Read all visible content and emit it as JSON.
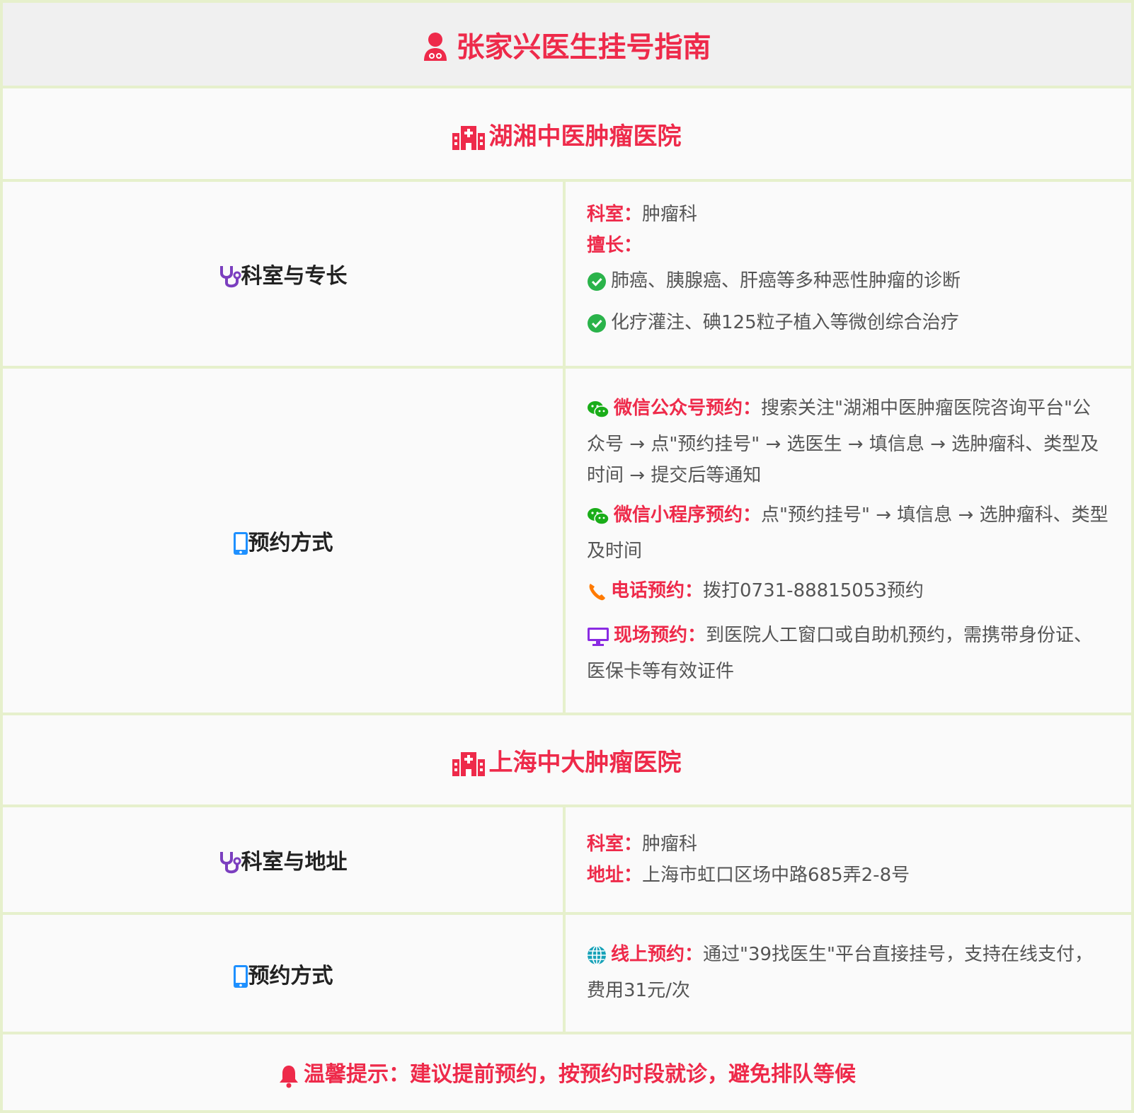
{
  "title": {
    "icon": "doctor-icon",
    "text": "张家兴医生挂号指南"
  },
  "hospitals": [
    {
      "icon": "hospital-icon",
      "name": "湖湘中医肿瘤医院",
      "dept_label": "科室与专长",
      "dept_label_icon": "stethoscope-icon",
      "dept_key": "科室：",
      "dept_value": "肿瘤科",
      "specialty_key": "擅长：",
      "specialties": [
        "肺癌、胰腺癌、肝癌等多种恶性肿瘤的诊断",
        "化疗灌注、碘125粒子植入等微创综合治疗"
      ],
      "booking_label": "预约方式",
      "booking_label_icon": "mobile-icon",
      "booking": [
        {
          "icon": "wechat-icon",
          "key": "微信公众号预约：",
          "text": "搜索关注\"湖湘中医肿瘤医院咨询平台\"公众号 → 点\"预约挂号\" → 选医生 → 填信息 → 选肿瘤科、类型及时间 → 提交后等通知"
        },
        {
          "icon": "wechat-icon",
          "key": "微信小程序预约：",
          "text": "点\"预约挂号\" → 填信息 → 选肿瘤科、类型及时间"
        },
        {
          "icon": "phone-icon",
          "key": "电话预约：",
          "text": "拨打0731-88815053预约"
        },
        {
          "icon": "desktop-icon",
          "key": "现场预约：",
          "text": "到医院人工窗口或自助机预约，需携带身份证、医保卡等有效证件"
        }
      ]
    },
    {
      "icon": "hospital-icon",
      "name": "上海中大肿瘤医院",
      "dept_label": "科室与地址",
      "dept_label_icon": "stethoscope-icon",
      "dept_key": "科室：",
      "dept_value": "肿瘤科",
      "address_key": "地址：",
      "address_value": "上海市虹口区场中路685弄2-8号",
      "booking_label": "预约方式",
      "booking_label_icon": "mobile-icon",
      "booking": [
        {
          "icon": "globe-icon",
          "key": "线上预约：",
          "text": "通过\"39找医生\"平台直接挂号，支持在线支付，费用31元/次"
        }
      ]
    }
  ],
  "tip": {
    "icon": "bell-icon",
    "text": "温馨提示：建议提前预约，按预约时段就诊，避免排队等候"
  },
  "colors": {
    "accent_red": "#ee2a4a",
    "border_green": "#e6f0cc",
    "check_green": "#2ab34a",
    "wechat_green": "#1aad19",
    "phone_orange": "#ff7a00",
    "desktop_purple": "#8a2be2",
    "stethoscope_purple": "#7b3fbf",
    "mobile_blue": "#1e90ff",
    "globe_teal": "#17a2b8"
  }
}
